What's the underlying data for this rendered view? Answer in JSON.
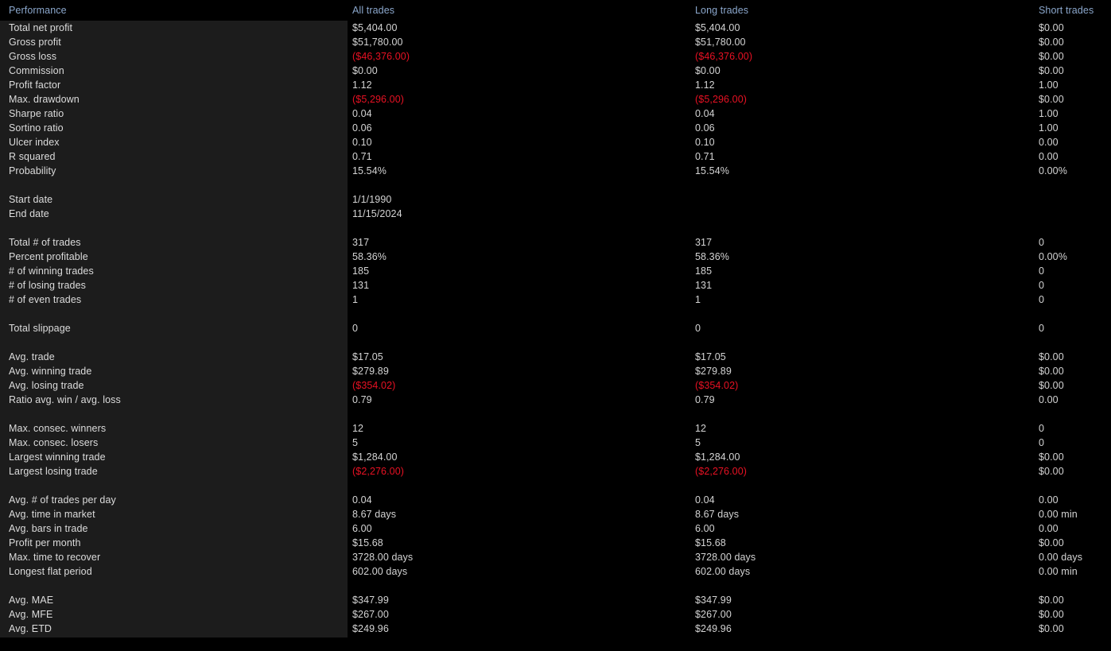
{
  "colors": {
    "background": "#000000",
    "label_panel": "#1c1c1c",
    "header_text": "#8ba7cc",
    "value_text": "#d4d4d4",
    "label_text": "#dcdcdc",
    "negative_text": "#e81123"
  },
  "headers": {
    "metric": "Performance",
    "all": "All trades",
    "long": "Long trades",
    "short": "Short trades"
  },
  "rows": [
    {
      "label": "Total net profit",
      "all": "$5,404.00",
      "long": "$5,404.00",
      "short": "$0.00"
    },
    {
      "label": "Gross profit",
      "all": "$51,780.00",
      "long": "$51,780.00",
      "short": "$0.00"
    },
    {
      "label": "Gross loss",
      "all": "($46,376.00)",
      "long": "($46,376.00)",
      "short": "$0.00",
      "all_neg": true,
      "long_neg": true
    },
    {
      "label": "Commission",
      "all": "$0.00",
      "long": "$0.00",
      "short": "$0.00"
    },
    {
      "label": "Profit factor",
      "all": "1.12",
      "long": "1.12",
      "short": "1.00"
    },
    {
      "label": "Max. drawdown",
      "all": "($5,296.00)",
      "long": "($5,296.00)",
      "short": "$0.00",
      "all_neg": true,
      "long_neg": true
    },
    {
      "label": "Sharpe ratio",
      "all": "0.04",
      "long": "0.04",
      "short": "1.00"
    },
    {
      "label": "Sortino ratio",
      "all": "0.06",
      "long": "0.06",
      "short": "1.00"
    },
    {
      "label": "Ulcer index",
      "all": "0.10",
      "long": "0.10",
      "short": "0.00"
    },
    {
      "label": "R squared",
      "all": "0.71",
      "long": "0.71",
      "short": "0.00"
    },
    {
      "label": "Probability",
      "all": "15.54%",
      "long": "15.54%",
      "short": "0.00%"
    },
    {
      "spacer": true
    },
    {
      "label": "Start date",
      "all": "1/1/1990",
      "long": "",
      "short": ""
    },
    {
      "label": "End date",
      "all": "11/15/2024",
      "long": "",
      "short": ""
    },
    {
      "spacer": true
    },
    {
      "label": "Total # of trades",
      "all": "317",
      "long": "317",
      "short": "0"
    },
    {
      "label": "Percent profitable",
      "all": "58.36%",
      "long": "58.36%",
      "short": "0.00%"
    },
    {
      "label": "# of winning trades",
      "all": "185",
      "long": "185",
      "short": "0"
    },
    {
      "label": "# of losing trades",
      "all": "131",
      "long": "131",
      "short": "0"
    },
    {
      "label": "# of even trades",
      "all": "1",
      "long": "1",
      "short": "0"
    },
    {
      "spacer": true
    },
    {
      "label": "Total slippage",
      "all": "0",
      "long": "0",
      "short": "0"
    },
    {
      "spacer": true
    },
    {
      "label": "Avg. trade",
      "all": "$17.05",
      "long": "$17.05",
      "short": "$0.00"
    },
    {
      "label": "Avg. winning trade",
      "all": "$279.89",
      "long": "$279.89",
      "short": "$0.00"
    },
    {
      "label": "Avg. losing trade",
      "all": "($354.02)",
      "long": "($354.02)",
      "short": "$0.00",
      "all_neg": true,
      "long_neg": true
    },
    {
      "label": "Ratio avg. win / avg. loss",
      "all": "0.79",
      "long": "0.79",
      "short": "0.00"
    },
    {
      "spacer": true
    },
    {
      "label": "Max. consec. winners",
      "all": "12",
      "long": "12",
      "short": "0"
    },
    {
      "label": "Max. consec. losers",
      "all": "5",
      "long": "5",
      "short": "0"
    },
    {
      "label": "Largest winning trade",
      "all": "$1,284.00",
      "long": "$1,284.00",
      "short": "$0.00"
    },
    {
      "label": "Largest losing trade",
      "all": "($2,276.00)",
      "long": "($2,276.00)",
      "short": "$0.00",
      "all_neg": true,
      "long_neg": true
    },
    {
      "spacer": true
    },
    {
      "label": "Avg. # of trades per day",
      "all": "0.04",
      "long": "0.04",
      "short": "0.00"
    },
    {
      "label": "Avg. time in market",
      "all": "8.67 days",
      "long": "8.67 days",
      "short": "0.00 min"
    },
    {
      "label": "Avg. bars in trade",
      "all": "6.00",
      "long": "6.00",
      "short": "0.00"
    },
    {
      "label": "Profit per month",
      "all": "$15.68",
      "long": "$15.68",
      "short": "$0.00"
    },
    {
      "label": "Max. time to recover",
      "all": "3728.00 days",
      "long": "3728.00 days",
      "short": "0.00 days"
    },
    {
      "label": "Longest flat period",
      "all": "602.00 days",
      "long": "602.00 days",
      "short": "0.00 min"
    },
    {
      "spacer": true
    },
    {
      "label": "Avg. MAE",
      "all": "$347.99",
      "long": "$347.99",
      "short": "$0.00"
    },
    {
      "label": "Avg. MFE",
      "all": "$267.00",
      "long": "$267.00",
      "short": "$0.00"
    },
    {
      "label": "Avg. ETD",
      "all": "$249.96",
      "long": "$249.96",
      "short": "$0.00"
    }
  ]
}
